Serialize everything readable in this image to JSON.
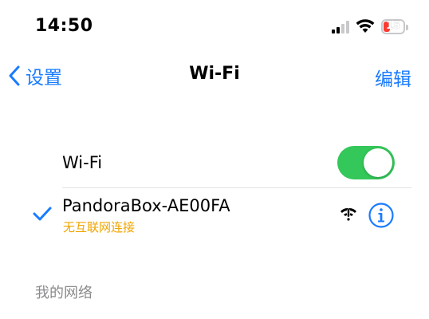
{
  "status_bar": {
    "time": "14:50",
    "battery_level": "15",
    "battery_color": "#ff3b30"
  },
  "nav": {
    "back_label": "设置",
    "title": "Wi-Fi",
    "edit_label": "编辑",
    "accent_color": "#1a7bff"
  },
  "wifi_toggle": {
    "label": "Wi-Fi",
    "on": true,
    "color": "#34c759"
  },
  "connected_network": {
    "name": "PandoraBox-AE00FA",
    "status": "无互联网连接",
    "status_color": "#f0a500",
    "icons": [
      "checkmark-icon",
      "wifi-no-internet-icon",
      "info-icon"
    ]
  },
  "sections": {
    "my_networks_header": "我的网络"
  }
}
